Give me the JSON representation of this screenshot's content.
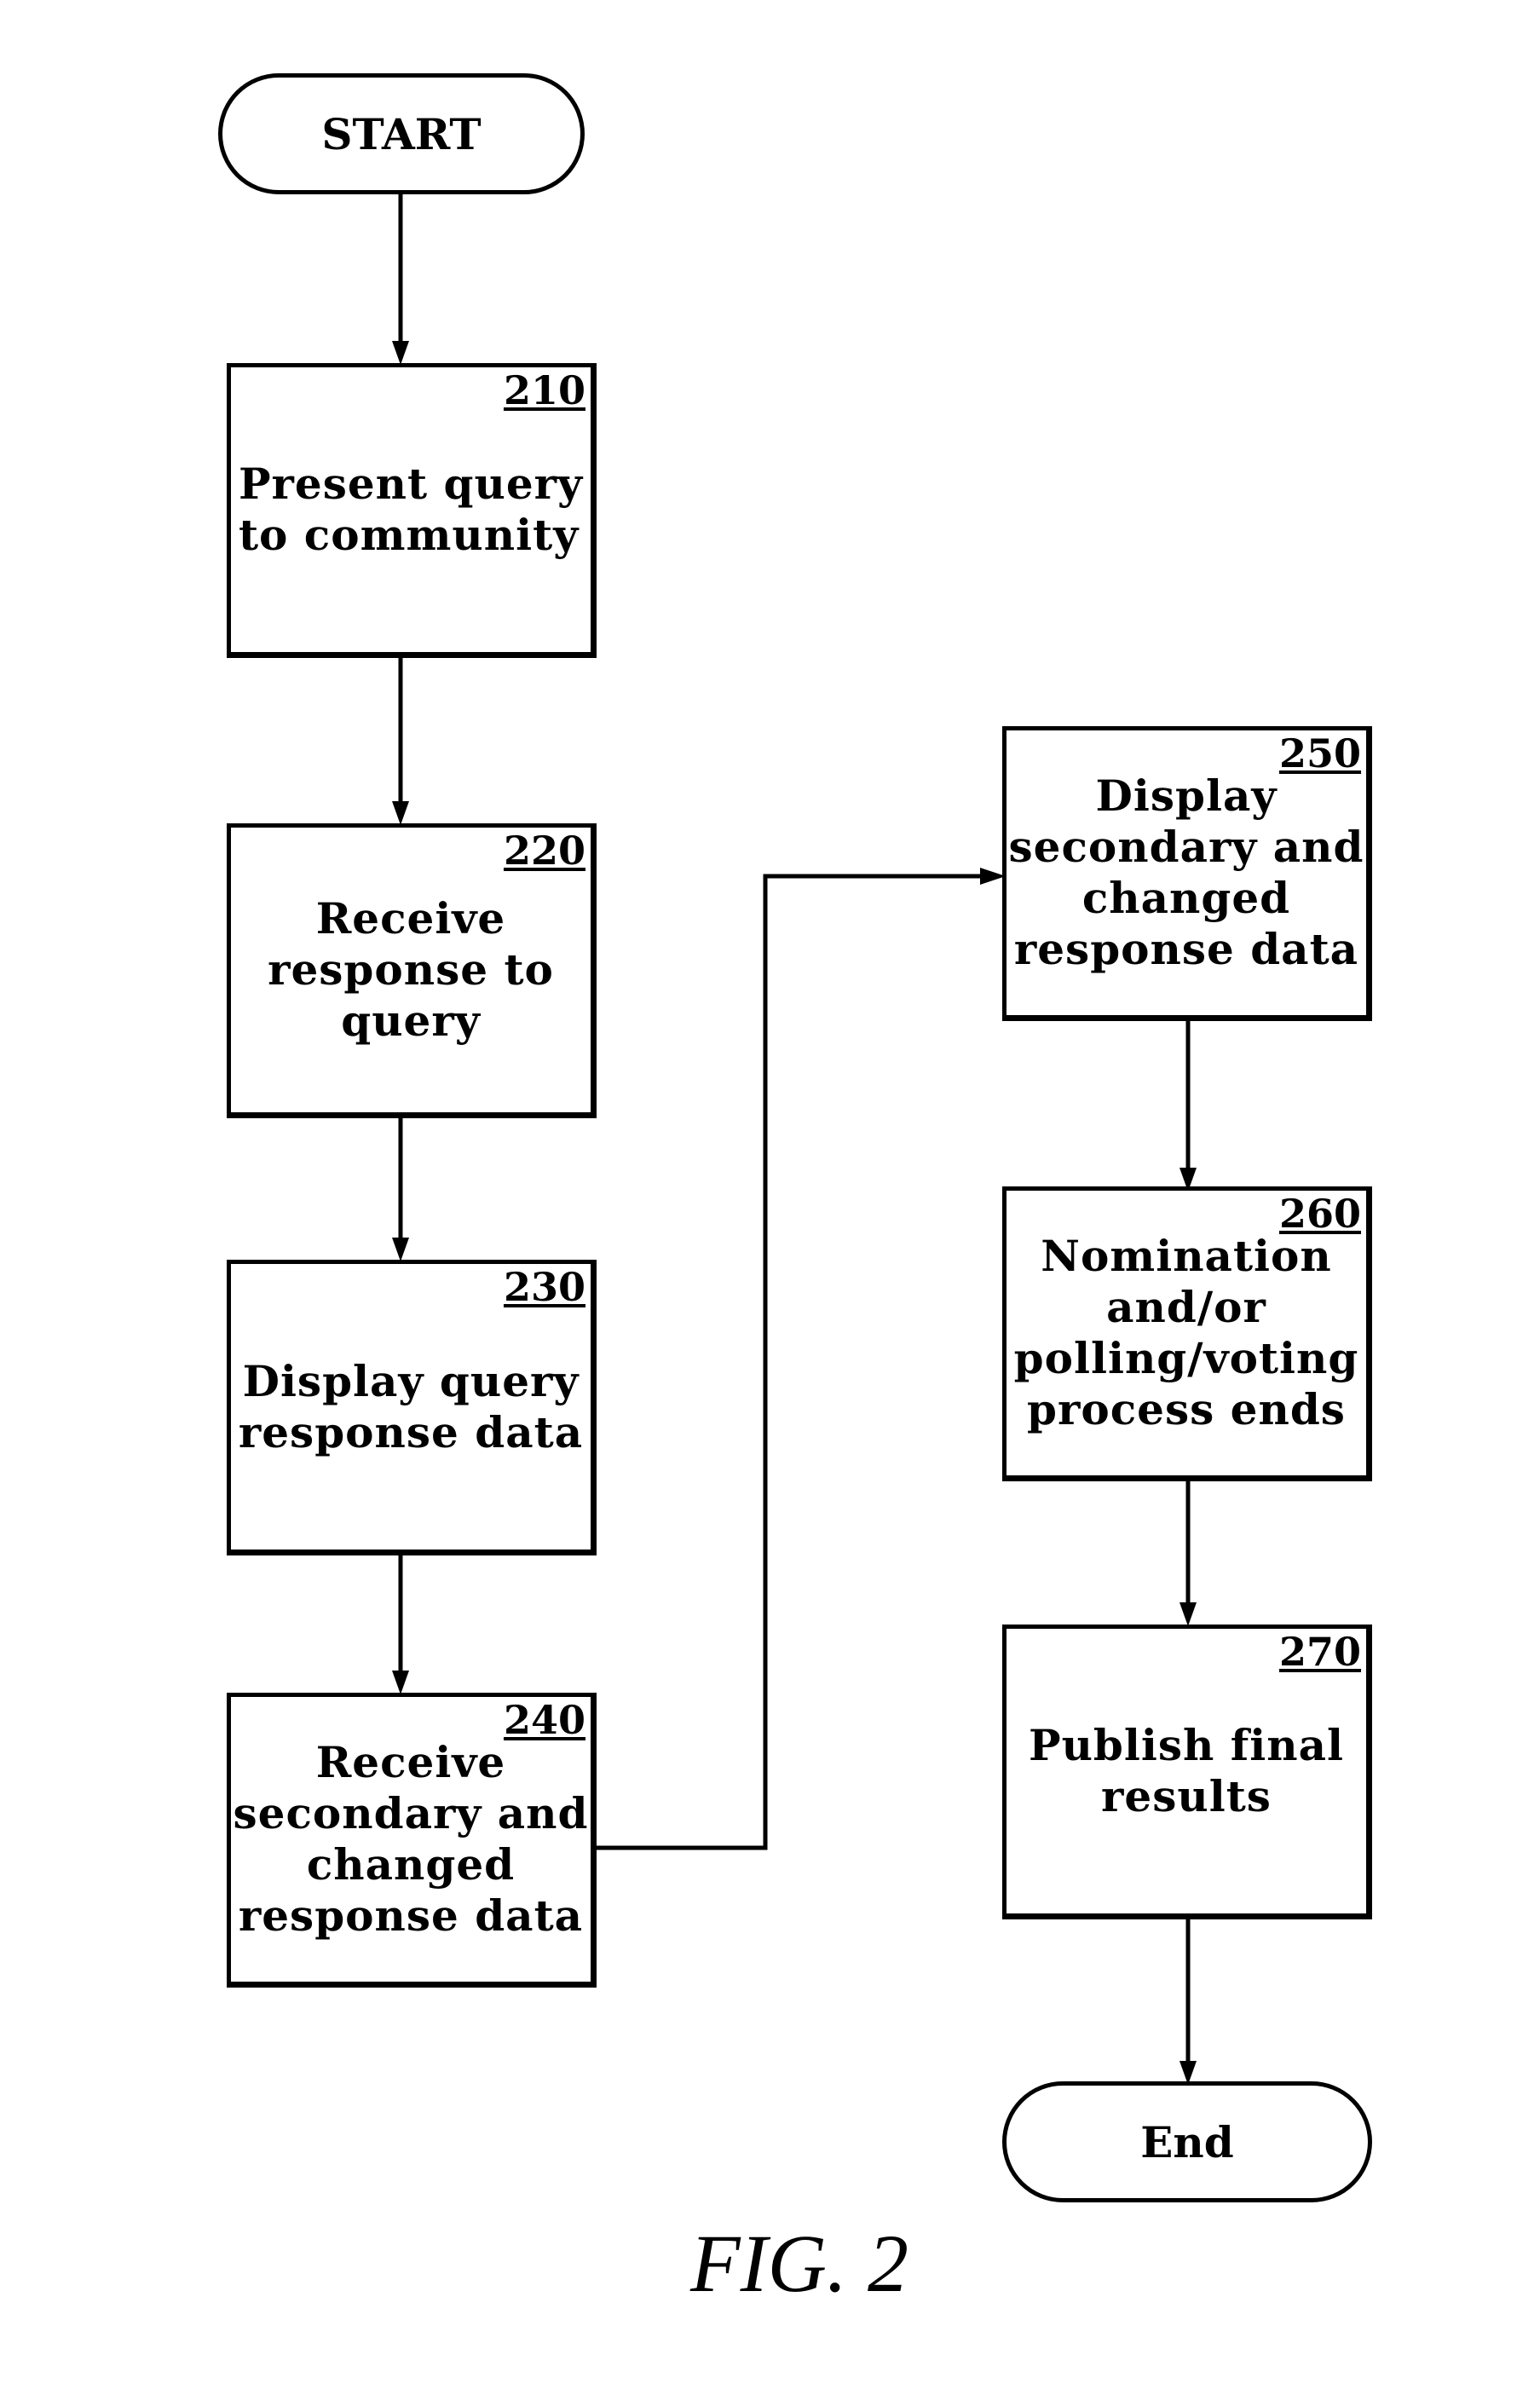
{
  "figure_label": "FIG. 2",
  "start": {
    "label": "START"
  },
  "end": {
    "label": "End"
  },
  "steps": [
    {
      "id": "210",
      "label": "Present query\nto community"
    },
    {
      "id": "220",
      "label": "Receive\nresponse to\nquery"
    },
    {
      "id": "230",
      "label": "Display query\nresponse data"
    },
    {
      "id": "240",
      "label": "Receive\nsecondary and\nchanged\nresponse data"
    },
    {
      "id": "250",
      "label": "Display\nsecondary and\nchanged\nresponse data"
    },
    {
      "id": "260",
      "label": "Nomination\nand/or\npolling/voting\nprocess ends"
    },
    {
      "id": "270",
      "label": "Publish final\nresults"
    }
  ]
}
